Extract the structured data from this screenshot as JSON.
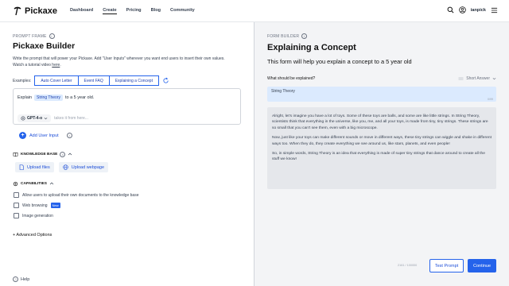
{
  "header": {
    "logo_text": "Pickaxe",
    "nav": [
      "Dashboard",
      "Create",
      "Pricing",
      "Blog",
      "Community"
    ],
    "active_nav": "Create",
    "username": "ianpick"
  },
  "left": {
    "section_label": "PROMPT FRAME",
    "title": "Pickaxe Builder",
    "description_line1": "Write the prompt that will power your Pickaxe. Add \"User Inputs\" wherever you want end users to insert their own values.",
    "description_line2_prefix": "Watch a tutorial video ",
    "description_link": "here",
    "description_suffix": ".",
    "examples_label": "Examples:",
    "examples": [
      "Auto Cover Letter",
      "Event FAQ",
      "Explaining a Concept"
    ],
    "prompt": {
      "prefix": "Explain",
      "chip": "String Theory",
      "suffix": "to a 5 year old."
    },
    "model": "GPT-4-o",
    "model_placeholder": "takes it from here...",
    "add_user_input": "Add User Input",
    "knowledge_base_label": "KNOWLEDGE BASE",
    "upload_files": "Upload files",
    "upload_webpage": "Upload webpage",
    "capabilities_label": "CAPABILITIES",
    "capabilities": [
      {
        "label": "Allow users to upload their own documents to the knowledge base"
      },
      {
        "label": "Web browsing",
        "badge": "New"
      },
      {
        "label": "Image generation"
      }
    ],
    "advanced": "+ Advanced Options",
    "help": "Help"
  },
  "right": {
    "section_label": "FORM BUILDER",
    "title": "Explaining a Concept",
    "subtitle": "This form will help you explain a concept to a 5 year old",
    "question": "What should be explained?",
    "answer_type": "Short Answer",
    "answer_value": "String Theory",
    "char_count": "0/99",
    "output_paragraphs": [
      "Alright, let's imagine you have a lot of toys. Some of these toys are balls, and some are like little strings. In String Theory, scientists think that everything in the universe, like you, me, and all your toys, is made from tiny, tiny strings. These strings are so small that you can't see them, even with a big microscope.",
      "Now, just like your toys can make different sounds or move in different ways, these tiny strings can wiggle and shake in different ways too. When they do, they create everything we see around us, like stars, planets, and even people!",
      "So, in simple words, String Theory is an idea that everything is made of super tiny strings that dance around to create all the stuff we know!"
    ],
    "token_count": "2161 / 100000",
    "test_prompt": "Test Prompt",
    "continue": "Continue"
  }
}
